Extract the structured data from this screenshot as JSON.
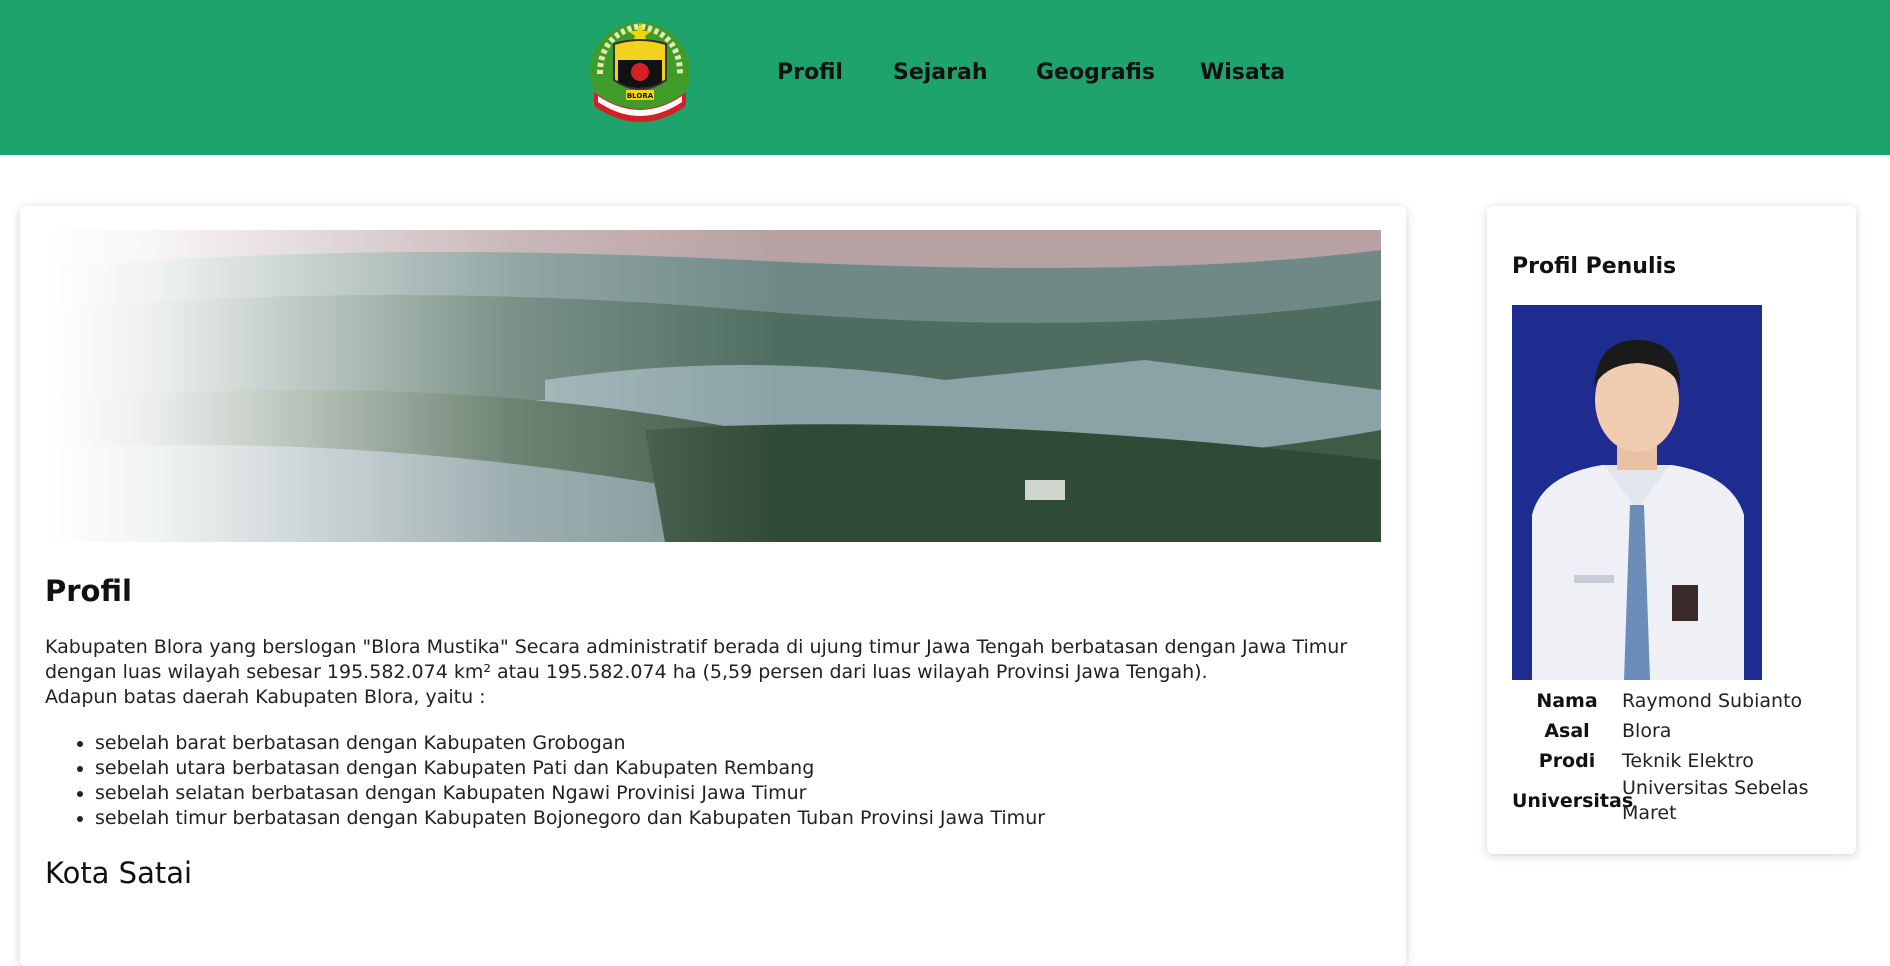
{
  "nav": {
    "links": [
      "Profil",
      "Sejarah",
      "Geografis",
      "Wisata"
    ],
    "logo_text": "BLORA",
    "logo_motto": "Sarwa Wangi Wetan Blora"
  },
  "main": {
    "title": "Profil",
    "paragraph_1": "Kabupaten Blora yang berslogan \"Blora Mustika\" Secara administratif berada di ujung timur Jawa Tengah berbatasan dengan Jawa Timur dengan luas wilayah sebesar 195.582.074 km² atau 195.582.074 ha (5,59 persen dari luas wilayah Provinsi Jawa Tengah).",
    "paragraph_2": "Adapun batas daerah Kabupaten Blora, yaitu :",
    "borders": [
      "sebelah barat berbatasan dengan Kabupaten Grobogan",
      "sebelah utara berbatasan dengan Kabupaten Pati dan Kabupaten Rembang",
      "sebelah selatan berbatasan dengan Kabupaten Ngawi Provinisi Jawa Timur",
      "sebelah timur berbatasan dengan Kabupaten Bojonegoro dan Kabupaten Tuban Provinsi Jawa Timur"
    ],
    "subtitle": "Kota Satai"
  },
  "sidebar": {
    "title": "Profil Penulis",
    "rows": [
      {
        "label": "Nama",
        "value": "Raymond Subianto"
      },
      {
        "label": "Asal",
        "value": "Blora"
      },
      {
        "label": "Prodi",
        "value": "Teknik Elektro"
      },
      {
        "label": "Universitas",
        "value": "Universitas Sebelas Maret"
      }
    ]
  },
  "colors": {
    "navbar": "#1fa36d",
    "logo_green": "#3f9b2a",
    "logo_red": "#d41f26",
    "photo_bg": "#1f2c8f"
  },
  "icons": {
    "logo": "blora-regency-emblem"
  }
}
